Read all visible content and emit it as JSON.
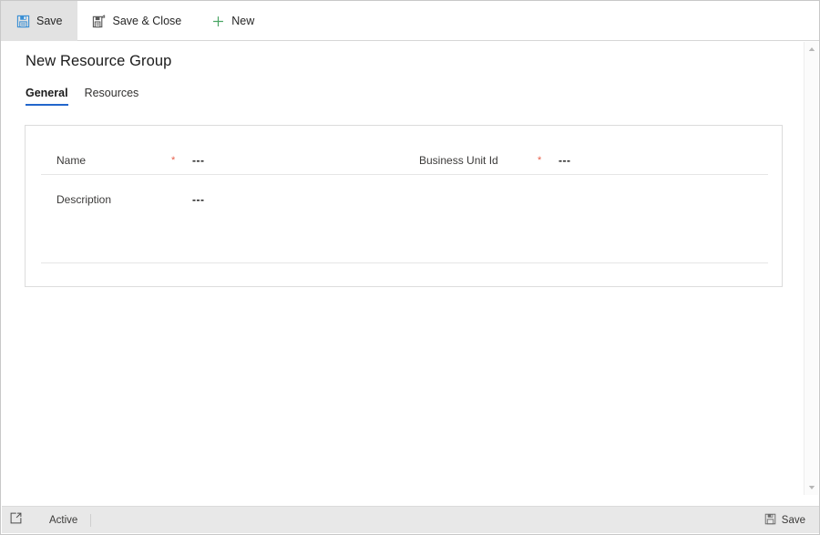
{
  "commandbar": {
    "buttons": [
      {
        "label": "Save",
        "icon": "save-floppy-icon",
        "active": true
      },
      {
        "label": "Save & Close",
        "icon": "save-and-close-icon",
        "active": false
      },
      {
        "label": "New",
        "icon": "plus-icon",
        "active": false
      }
    ]
  },
  "page": {
    "title": "New Resource Group",
    "tabs": [
      {
        "label": "General",
        "selected": true
      },
      {
        "label": "Resources",
        "selected": false
      }
    ]
  },
  "form": {
    "fields": [
      {
        "label": "Name",
        "required": true,
        "value": "---"
      },
      {
        "label": "Business Unit Id",
        "required": true,
        "value": "---"
      },
      {
        "label": "Description",
        "required": false,
        "value": "---"
      }
    ]
  },
  "statusbar": {
    "popout_icon": "open-in-new-window-icon",
    "status": "Active",
    "save_label": "Save",
    "save_icon": "save-floppy-icon"
  },
  "colors": {
    "accent": "#2266cc",
    "required": "#e8604c",
    "new_green": "#4aa564",
    "save_blue": "#3a8fd4"
  }
}
